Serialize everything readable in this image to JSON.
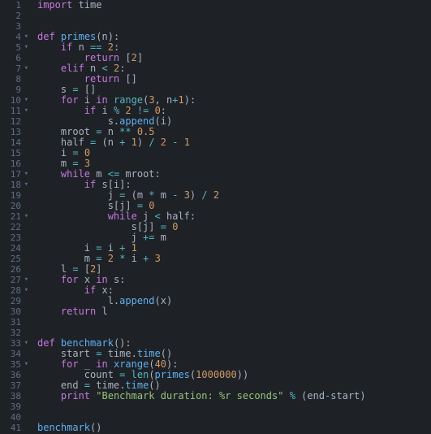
{
  "lines": [
    {
      "n": 1,
      "fold": "",
      "segs": [
        {
          "c": "kw",
          "t": "import"
        },
        {
          "c": "txt",
          "t": " time"
        }
      ]
    },
    {
      "n": 2,
      "fold": "",
      "segs": []
    },
    {
      "n": 3,
      "fold": "",
      "segs": []
    },
    {
      "n": 4,
      "fold": "▾",
      "segs": [
        {
          "c": "kw",
          "t": "def"
        },
        {
          "c": "txt",
          "t": " "
        },
        {
          "c": "name",
          "t": "primes"
        },
        {
          "c": "txt",
          "t": "(n):"
        }
      ]
    },
    {
      "n": 5,
      "fold": "▾",
      "segs": [
        {
          "c": "txt",
          "t": "    "
        },
        {
          "c": "kw",
          "t": "if"
        },
        {
          "c": "txt",
          "t": " n "
        },
        {
          "c": "op",
          "t": "=="
        },
        {
          "c": "txt",
          "t": " "
        },
        {
          "c": "num",
          "t": "2"
        },
        {
          "c": "txt",
          "t": ":"
        }
      ]
    },
    {
      "n": 6,
      "fold": "",
      "segs": [
        {
          "c": "txt",
          "t": "        "
        },
        {
          "c": "kw",
          "t": "return"
        },
        {
          "c": "txt",
          "t": " ["
        },
        {
          "c": "num",
          "t": "2"
        },
        {
          "c": "txt",
          "t": "]"
        }
      ]
    },
    {
      "n": 7,
      "fold": "▾",
      "segs": [
        {
          "c": "txt",
          "t": "    "
        },
        {
          "c": "kw",
          "t": "elif"
        },
        {
          "c": "txt",
          "t": " n "
        },
        {
          "c": "op",
          "t": "<"
        },
        {
          "c": "txt",
          "t": " "
        },
        {
          "c": "num",
          "t": "2"
        },
        {
          "c": "txt",
          "t": ":"
        }
      ]
    },
    {
      "n": 8,
      "fold": "",
      "segs": [
        {
          "c": "txt",
          "t": "        "
        },
        {
          "c": "kw",
          "t": "return"
        },
        {
          "c": "txt",
          "t": " []"
        }
      ]
    },
    {
      "n": 9,
      "fold": "",
      "segs": [
        {
          "c": "txt",
          "t": "    s "
        },
        {
          "c": "op",
          "t": "="
        },
        {
          "c": "txt",
          "t": " []"
        }
      ]
    },
    {
      "n": 10,
      "fold": "▾",
      "segs": [
        {
          "c": "txt",
          "t": "    "
        },
        {
          "c": "kw",
          "t": "for"
        },
        {
          "c": "txt",
          "t": " i "
        },
        {
          "c": "kw",
          "t": "in"
        },
        {
          "c": "txt",
          "t": " "
        },
        {
          "c": "builtin",
          "t": "range"
        },
        {
          "c": "txt",
          "t": "("
        },
        {
          "c": "num",
          "t": "3"
        },
        {
          "c": "txt",
          "t": ", n"
        },
        {
          "c": "op",
          "t": "+"
        },
        {
          "c": "num",
          "t": "1"
        },
        {
          "c": "txt",
          "t": "):"
        }
      ]
    },
    {
      "n": 11,
      "fold": "▾",
      "segs": [
        {
          "c": "txt",
          "t": "        "
        },
        {
          "c": "kw",
          "t": "if"
        },
        {
          "c": "txt",
          "t": " i "
        },
        {
          "c": "op",
          "t": "%"
        },
        {
          "c": "txt",
          "t": " "
        },
        {
          "c": "num",
          "t": "2"
        },
        {
          "c": "txt",
          "t": " "
        },
        {
          "c": "op",
          "t": "!="
        },
        {
          "c": "txt",
          "t": " "
        },
        {
          "c": "num",
          "t": "0"
        },
        {
          "c": "txt",
          "t": ":"
        }
      ]
    },
    {
      "n": 12,
      "fold": "",
      "segs": [
        {
          "c": "txt",
          "t": "            s."
        },
        {
          "c": "fn",
          "t": "append"
        },
        {
          "c": "txt",
          "t": "(i)"
        }
      ]
    },
    {
      "n": 13,
      "fold": "",
      "segs": [
        {
          "c": "txt",
          "t": "    mroot "
        },
        {
          "c": "op",
          "t": "="
        },
        {
          "c": "txt",
          "t": " n "
        },
        {
          "c": "op",
          "t": "**"
        },
        {
          "c": "txt",
          "t": " "
        },
        {
          "c": "num",
          "t": "0.5"
        }
      ]
    },
    {
      "n": 14,
      "fold": "",
      "segs": [
        {
          "c": "txt",
          "t": "    half "
        },
        {
          "c": "op",
          "t": "="
        },
        {
          "c": "txt",
          "t": " (n "
        },
        {
          "c": "op",
          "t": "+"
        },
        {
          "c": "txt",
          "t": " "
        },
        {
          "c": "num",
          "t": "1"
        },
        {
          "c": "txt",
          "t": ") "
        },
        {
          "c": "op",
          "t": "/"
        },
        {
          "c": "txt",
          "t": " "
        },
        {
          "c": "num",
          "t": "2"
        },
        {
          "c": "txt",
          "t": " "
        },
        {
          "c": "op",
          "t": "-"
        },
        {
          "c": "txt",
          "t": " "
        },
        {
          "c": "num",
          "t": "1"
        }
      ]
    },
    {
      "n": 15,
      "fold": "",
      "segs": [
        {
          "c": "txt",
          "t": "    i "
        },
        {
          "c": "op",
          "t": "="
        },
        {
          "c": "txt",
          "t": " "
        },
        {
          "c": "num",
          "t": "0"
        }
      ]
    },
    {
      "n": 16,
      "fold": "",
      "segs": [
        {
          "c": "txt",
          "t": "    m "
        },
        {
          "c": "op",
          "t": "="
        },
        {
          "c": "txt",
          "t": " "
        },
        {
          "c": "num",
          "t": "3"
        }
      ]
    },
    {
      "n": 17,
      "fold": "▾",
      "segs": [
        {
          "c": "txt",
          "t": "    "
        },
        {
          "c": "kw",
          "t": "while"
        },
        {
          "c": "txt",
          "t": " m "
        },
        {
          "c": "op",
          "t": "<="
        },
        {
          "c": "txt",
          "t": " mroot:"
        }
      ]
    },
    {
      "n": 18,
      "fold": "▾",
      "segs": [
        {
          "c": "txt",
          "t": "        "
        },
        {
          "c": "kw",
          "t": "if"
        },
        {
          "c": "txt",
          "t": " s[i]:"
        }
      ]
    },
    {
      "n": 19,
      "fold": "",
      "segs": [
        {
          "c": "txt",
          "t": "            j "
        },
        {
          "c": "op",
          "t": "="
        },
        {
          "c": "txt",
          "t": " (m "
        },
        {
          "c": "op",
          "t": "*"
        },
        {
          "c": "txt",
          "t": " m "
        },
        {
          "c": "op",
          "t": "-"
        },
        {
          "c": "txt",
          "t": " "
        },
        {
          "c": "num",
          "t": "3"
        },
        {
          "c": "txt",
          "t": ") "
        },
        {
          "c": "op",
          "t": "/"
        },
        {
          "c": "txt",
          "t": " "
        },
        {
          "c": "num",
          "t": "2"
        }
      ]
    },
    {
      "n": 20,
      "fold": "",
      "segs": [
        {
          "c": "txt",
          "t": "            s[j] "
        },
        {
          "c": "op",
          "t": "="
        },
        {
          "c": "txt",
          "t": " "
        },
        {
          "c": "num",
          "t": "0"
        }
      ]
    },
    {
      "n": 21,
      "fold": "▾",
      "segs": [
        {
          "c": "txt",
          "t": "            "
        },
        {
          "c": "kw",
          "t": "while"
        },
        {
          "c": "txt",
          "t": " j "
        },
        {
          "c": "op",
          "t": "<"
        },
        {
          "c": "txt",
          "t": " half:"
        }
      ]
    },
    {
      "n": 22,
      "fold": "",
      "segs": [
        {
          "c": "txt",
          "t": "                s[j] "
        },
        {
          "c": "op",
          "t": "="
        },
        {
          "c": "txt",
          "t": " "
        },
        {
          "c": "num",
          "t": "0"
        }
      ]
    },
    {
      "n": 23,
      "fold": "",
      "segs": [
        {
          "c": "txt",
          "t": "                j "
        },
        {
          "c": "op",
          "t": "+="
        },
        {
          "c": "txt",
          "t": " m"
        }
      ]
    },
    {
      "n": 24,
      "fold": "",
      "segs": [
        {
          "c": "txt",
          "t": "        i "
        },
        {
          "c": "op",
          "t": "="
        },
        {
          "c": "txt",
          "t": " i "
        },
        {
          "c": "op",
          "t": "+"
        },
        {
          "c": "txt",
          "t": " "
        },
        {
          "c": "num",
          "t": "1"
        }
      ]
    },
    {
      "n": 25,
      "fold": "",
      "segs": [
        {
          "c": "txt",
          "t": "        m "
        },
        {
          "c": "op",
          "t": "="
        },
        {
          "c": "txt",
          "t": " "
        },
        {
          "c": "num",
          "t": "2"
        },
        {
          "c": "txt",
          "t": " "
        },
        {
          "c": "op",
          "t": "*"
        },
        {
          "c": "txt",
          "t": " i "
        },
        {
          "c": "op",
          "t": "+"
        },
        {
          "c": "txt",
          "t": " "
        },
        {
          "c": "num",
          "t": "3"
        }
      ]
    },
    {
      "n": 26,
      "fold": "",
      "segs": [
        {
          "c": "txt",
          "t": "    l "
        },
        {
          "c": "op",
          "t": "="
        },
        {
          "c": "txt",
          "t": " ["
        },
        {
          "c": "num",
          "t": "2"
        },
        {
          "c": "txt",
          "t": "]"
        }
      ]
    },
    {
      "n": 27,
      "fold": "▾",
      "segs": [
        {
          "c": "txt",
          "t": "    "
        },
        {
          "c": "kw",
          "t": "for"
        },
        {
          "c": "txt",
          "t": " x "
        },
        {
          "c": "kw",
          "t": "in"
        },
        {
          "c": "txt",
          "t": " s:"
        }
      ]
    },
    {
      "n": 28,
      "fold": "▾",
      "segs": [
        {
          "c": "txt",
          "t": "        "
        },
        {
          "c": "kw",
          "t": "if"
        },
        {
          "c": "txt",
          "t": " x:"
        }
      ]
    },
    {
      "n": 29,
      "fold": "",
      "segs": [
        {
          "c": "txt",
          "t": "            l."
        },
        {
          "c": "fn",
          "t": "append"
        },
        {
          "c": "txt",
          "t": "(x)"
        }
      ]
    },
    {
      "n": 30,
      "fold": "",
      "segs": [
        {
          "c": "txt",
          "t": "    "
        },
        {
          "c": "kw",
          "t": "return"
        },
        {
          "c": "txt",
          "t": " l"
        }
      ]
    },
    {
      "n": 31,
      "fold": "",
      "segs": []
    },
    {
      "n": 32,
      "fold": "",
      "segs": []
    },
    {
      "n": 33,
      "fold": "▾",
      "segs": [
        {
          "c": "kw",
          "t": "def"
        },
        {
          "c": "txt",
          "t": " "
        },
        {
          "c": "name",
          "t": "benchmark"
        },
        {
          "c": "txt",
          "t": "():"
        }
      ]
    },
    {
      "n": 34,
      "fold": "",
      "segs": [
        {
          "c": "txt",
          "t": "    start "
        },
        {
          "c": "op",
          "t": "="
        },
        {
          "c": "txt",
          "t": " time."
        },
        {
          "c": "fn",
          "t": "time"
        },
        {
          "c": "txt",
          "t": "()"
        }
      ]
    },
    {
      "n": 35,
      "fold": "▾",
      "segs": [
        {
          "c": "txt",
          "t": "    "
        },
        {
          "c": "kw",
          "t": "for"
        },
        {
          "c": "txt",
          "t": " _ "
        },
        {
          "c": "kw",
          "t": "in"
        },
        {
          "c": "txt",
          "t": " "
        },
        {
          "c": "fn",
          "t": "xrange"
        },
        {
          "c": "txt",
          "t": "("
        },
        {
          "c": "num",
          "t": "40"
        },
        {
          "c": "txt",
          "t": "):"
        }
      ]
    },
    {
      "n": 36,
      "fold": "",
      "segs": [
        {
          "c": "txt",
          "t": "        count "
        },
        {
          "c": "op",
          "t": "="
        },
        {
          "c": "txt",
          "t": " "
        },
        {
          "c": "builtin",
          "t": "len"
        },
        {
          "c": "txt",
          "t": "("
        },
        {
          "c": "fn",
          "t": "primes"
        },
        {
          "c": "txt",
          "t": "("
        },
        {
          "c": "num",
          "t": "1000000"
        },
        {
          "c": "txt",
          "t": "))"
        }
      ]
    },
    {
      "n": 37,
      "fold": "",
      "segs": [
        {
          "c": "txt",
          "t": "    end "
        },
        {
          "c": "op",
          "t": "="
        },
        {
          "c": "txt",
          "t": " time."
        },
        {
          "c": "fn",
          "t": "time"
        },
        {
          "c": "txt",
          "t": "()"
        }
      ]
    },
    {
      "n": 38,
      "fold": "",
      "segs": [
        {
          "c": "txt",
          "t": "    "
        },
        {
          "c": "kw",
          "t": "print"
        },
        {
          "c": "txt",
          "t": " "
        },
        {
          "c": "str",
          "t": "\"Benchmark duration: %r seconds\""
        },
        {
          "c": "txt",
          "t": " "
        },
        {
          "c": "op",
          "t": "%"
        },
        {
          "c": "txt",
          "t": " (end"
        },
        {
          "c": "op",
          "t": "-"
        },
        {
          "c": "txt",
          "t": "start)"
        }
      ]
    },
    {
      "n": 39,
      "fold": "",
      "segs": []
    },
    {
      "n": 40,
      "fold": "",
      "segs": []
    },
    {
      "n": 41,
      "fold": "",
      "segs": [
        {
          "c": "fn",
          "t": "benchmark"
        },
        {
          "c": "txt",
          "t": "()"
        }
      ]
    }
  ]
}
